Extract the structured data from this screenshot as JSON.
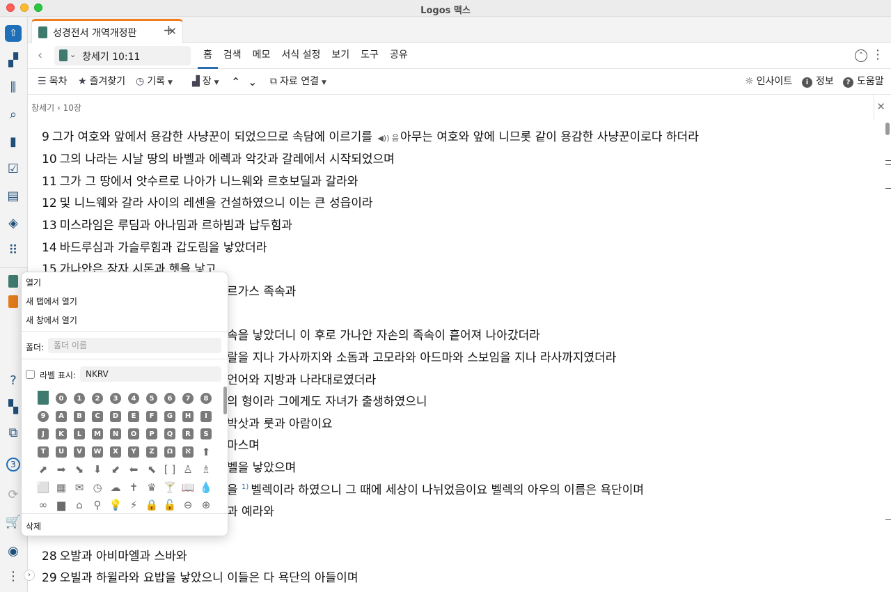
{
  "window": {
    "title": "Logos 맥스"
  },
  "tab": {
    "title": "성경전서 개역개정판",
    "close": "✕",
    "add": "+"
  },
  "nav": {
    "reference": "창세기 10:11",
    "menu": [
      "홈",
      "검색",
      "메모",
      "서식 설정",
      "보기",
      "도구",
      "공유"
    ],
    "active_menu": "홈"
  },
  "toolbar": {
    "toc": "목차",
    "favorites": "즐겨찾기",
    "history": "기록",
    "chapter": "장",
    "links": "자료 연결",
    "insight": "인사이트",
    "info": "정보",
    "help": "도움말"
  },
  "breadcrumb": {
    "book": "창세기",
    "separator": "›",
    "chapter": "10장"
  },
  "verses": [
    {
      "num": "9",
      "text": "그가 여호와 앞에서 용감한 사냥꾼이 되었으므로 속담에 이르기를 ",
      "audio": "◀)) 음",
      "rest": "아무는 여호와 앞에 니므롯 같이 용감한 사냥꾼이로다 하더라"
    },
    {
      "num": "10",
      "text": "그의 나라는 시날 땅의 바벨과 에렉과 악갓과 갈레에서 시작되었으며"
    },
    {
      "num": "11",
      "text": "그가 그 땅에서 앗수르로 나아가 니느웨와 르호보딜과 갈라와"
    },
    {
      "num": "12",
      "text": "및 니느웨와 갈라 사이의 레센을 건설하였으니 이는 큰 성읍이라"
    },
    {
      "num": "13",
      "text": "미스라임은 루딤과 아나밈과 르하빔과 납두힘과"
    },
    {
      "num": "14",
      "text": "바드루심과 가슬루힘과 갑도림을 낳았더라"
    },
    {
      "num": "15",
      "text": "가나안은 장자 시돈과 헷을 낳고"
    },
    {
      "num": "",
      "text": "르가스 족속과"
    },
    {
      "num": "",
      "text": "속을 낳았더니 이 후로 가나안 자손의 족속이 흩어져 나아갔더라"
    },
    {
      "num": "",
      "text": "랄을 지나 가사까지와 소돔과 고모라와 아드마와 스보임을 지나 라사까지였더라"
    },
    {
      "num": "",
      "text": "언어와 지방과 나라대로였더라"
    },
    {
      "num": "",
      "text": "의 형이라 그에게도 자녀가 출생하였으니"
    },
    {
      "num": "",
      "text": "박삿과 룻과 아람이요"
    },
    {
      "num": "",
      "text": "마스며"
    },
    {
      "num": "",
      "text": "벨을 낳았으며"
    },
    {
      "num": "",
      "text": "을 ",
      "footnote": "1)",
      "rest": "벨렉이라 하였으니 그 때에 세상이 나뉘었음이요 벨렉의 아우의 이름은 욕단이며"
    },
    {
      "num": "",
      "text": "과 예라와"
    },
    {
      "num": "28",
      "text": "오발과 아비마엘과 스바와"
    },
    {
      "num": "29",
      "text": "오빌과 하윌라와 요밥을 낳았으니 이들은 다 욕단의 아들이며"
    }
  ],
  "context_menu": {
    "open": "열기",
    "open_new_tab": "새 탭에서 열기",
    "open_new_window": "새 창에서 열기",
    "folder_label": "폴더:",
    "folder_placeholder": "폴더 이름",
    "show_label": "라벨 표시:",
    "label_value": "NKRV",
    "delete": "삭제",
    "grid_row1": [
      "0",
      "1",
      "2",
      "3",
      "4",
      "5",
      "6",
      "7",
      "8"
    ],
    "grid_row2": [
      "9",
      "A",
      "B",
      "C",
      "D",
      "E",
      "F",
      "G",
      "H",
      "I"
    ],
    "grid_row3": [
      "J",
      "K",
      "L",
      "M",
      "N",
      "O",
      "P",
      "Q",
      "R",
      "S"
    ],
    "grid_row4": [
      "T",
      "U",
      "V",
      "W",
      "X",
      "Y",
      "Z",
      "Ω",
      "ℵ",
      "⬆"
    ],
    "grid_row5": [
      "⬈",
      "➡",
      "⬊",
      "⬇",
      "⬋",
      "⬅",
      "⬉",
      "[ ]",
      "♙",
      "♗"
    ],
    "grid_row6": [
      "⬜",
      "▦",
      "✉",
      "◷",
      "☁",
      "✝",
      "♛",
      "🍸",
      "📖",
      "💧"
    ],
    "grid_row7": [
      "∞",
      "▆",
      "⌂",
      "⚲",
      "💡",
      "⚡",
      "🔒",
      "🔓",
      "⊖",
      "⊕"
    ]
  },
  "sidebar": {
    "notification_count": "3"
  },
  "colors": {
    "accent": "#2b6cb0",
    "tab_accent": "#f07c1b",
    "book_cover": "#3f7a6e"
  }
}
